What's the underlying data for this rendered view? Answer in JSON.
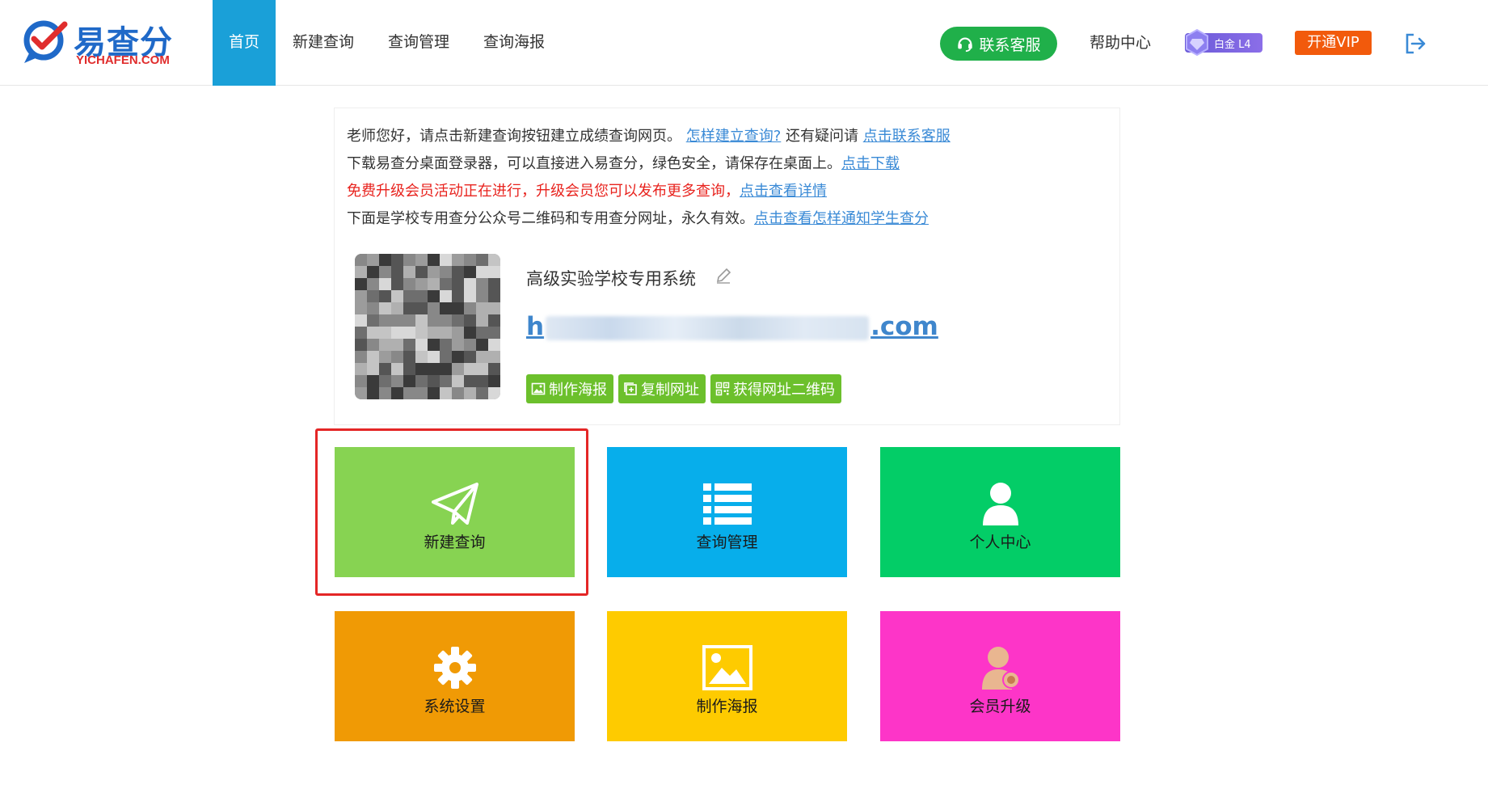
{
  "brand": {
    "name_cn": "易查分",
    "name_en": "YICHAFEN.COM",
    "color_blue": "#1f69c8",
    "color_red": "#e02d2d"
  },
  "nav": {
    "items": [
      {
        "label": "首页",
        "active": true
      },
      {
        "label": "新建查询",
        "active": false
      },
      {
        "label": "查询管理",
        "active": false
      },
      {
        "label": "查询海报",
        "active": false
      }
    ],
    "active_color": "#1aa0d8"
  },
  "header": {
    "service_label": "联系客服",
    "help_label": "帮助中心",
    "badge_label": "白金 L4",
    "vip_label": "开通VIP",
    "logout_icon": "logout-icon"
  },
  "notice": {
    "line1_text": "老师您好，请点击新建查询按钮建立成绩查询网页。",
    "line1_link": "怎样建立查询?",
    "line1_text2": "还有疑问请",
    "line1_link2": "点击联系客服",
    "line2_text": "下载易查分桌面登录器，可以直接进入易查分，绿色安全，请保存在桌面上。",
    "line2_link": "点击下载",
    "line3_text": "免费升级会员活动正在进行，升级会员您可以发布更多查询，",
    "line3_link": "点击查看详情",
    "line4_text": "下面是学校专用查分公众号二维码和专用查分网址，永久有效。",
    "line4_link": "点击查看怎样通知学生查分"
  },
  "school": {
    "name": "高级实验学校专用系统",
    "url_prefix": "h",
    "url_suffix": ".com"
  },
  "school_actions": [
    {
      "label": "制作海报",
      "icon": "image-icon"
    },
    {
      "label": "复制网址",
      "icon": "copy-icon"
    },
    {
      "label": "获得网址二维码",
      "icon": "qrcode-icon"
    }
  ],
  "tiles": [
    {
      "label": "新建查询",
      "icon": "paper-plane-icon",
      "color": "#87d352"
    },
    {
      "label": "查询管理",
      "icon": "list-icon",
      "color": "#07aeeb"
    },
    {
      "label": "个人中心",
      "icon": "user-icon",
      "color": "#03cd67"
    },
    {
      "label": "系统设置",
      "icon": "gear-icon",
      "color": "#f09a05"
    },
    {
      "label": "制作海报",
      "icon": "picture-icon",
      "color": "#fecb00"
    },
    {
      "label": "会员升级",
      "icon": "member-upgrade-icon",
      "color": "#fd35c8"
    }
  ],
  "colors": {
    "link": "#3a8ad6",
    "notice_red": "#e8231e",
    "action_green": "#6cc02c",
    "service_green": "#20b04a",
    "vip_orange": "#f25a0c",
    "highlight_red": "#e42626"
  }
}
